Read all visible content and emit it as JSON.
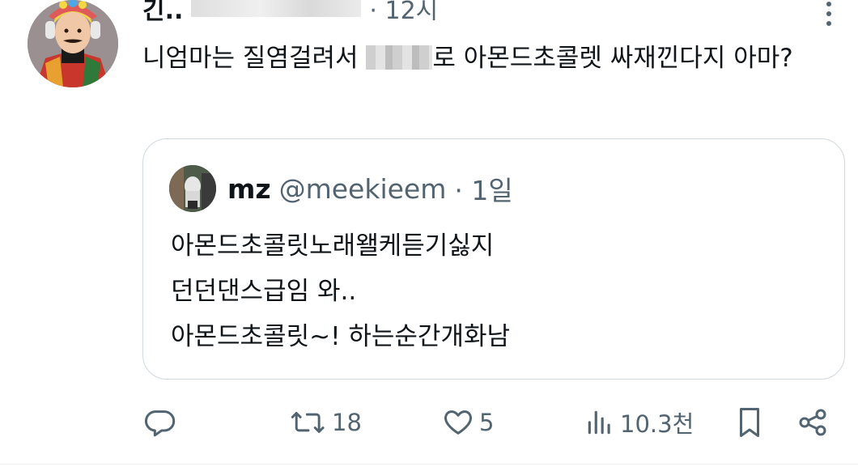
{
  "tweet": {
    "author_name": "긴..",
    "timestamp": "· 12시",
    "text_before_mosaic": "니엄마는 질염걸려서 ",
    "text_after_mosaic": "로 아몬드초콜렛 싸재낀다지 아마?"
  },
  "quote": {
    "name": "mz",
    "handle": "@meekieem",
    "timestamp": "· 1일",
    "lines": [
      "아몬드초콜릿노래왤케듣기싫지",
      "던던댄스급임 와..",
      "아몬드초콜릿~! 하는순간개화남"
    ]
  },
  "actions": {
    "reply_count": "",
    "retweet_count": "18",
    "like_count": "5",
    "views_count": "10.3천"
  },
  "icons": [
    "more-icon",
    "reply-icon",
    "retweet-icon",
    "like-icon",
    "views-icon",
    "bookmark-icon",
    "share-icon"
  ],
  "colors": {
    "text": "#0f1419",
    "secondary": "#536471",
    "border": "#cfd9de"
  }
}
